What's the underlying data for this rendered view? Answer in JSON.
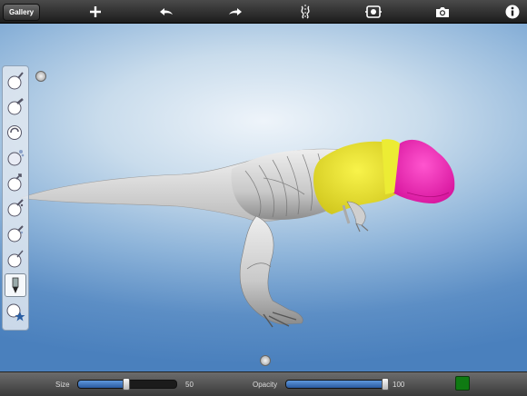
{
  "toolbar": {
    "gallery_label": "Gallery",
    "icons": [
      "add-icon",
      "undo-icon",
      "redo-icon",
      "symmetry-icon",
      "recenter-icon",
      "camera-icon",
      "info-icon"
    ]
  },
  "tools": {
    "items": [
      "draw-brush",
      "flatten-brush",
      "pinch-brush",
      "smooth-brush",
      "grab-brush",
      "inflate-brush",
      "stamp-brush",
      "crease-brush",
      "paint-brush",
      "material-brush"
    ],
    "active": "paint-brush"
  },
  "bottom": {
    "size_label": "Size",
    "size_value": "50",
    "size_level": 0.5,
    "opacity_label": "Opacity",
    "opacity_value": "100",
    "opacity_level": 1.0,
    "color": "#0f7a12"
  },
  "paint_colors": {
    "body": "#d9d9d9",
    "chest": "#f2ec2a",
    "head": "#ee1aa6"
  }
}
